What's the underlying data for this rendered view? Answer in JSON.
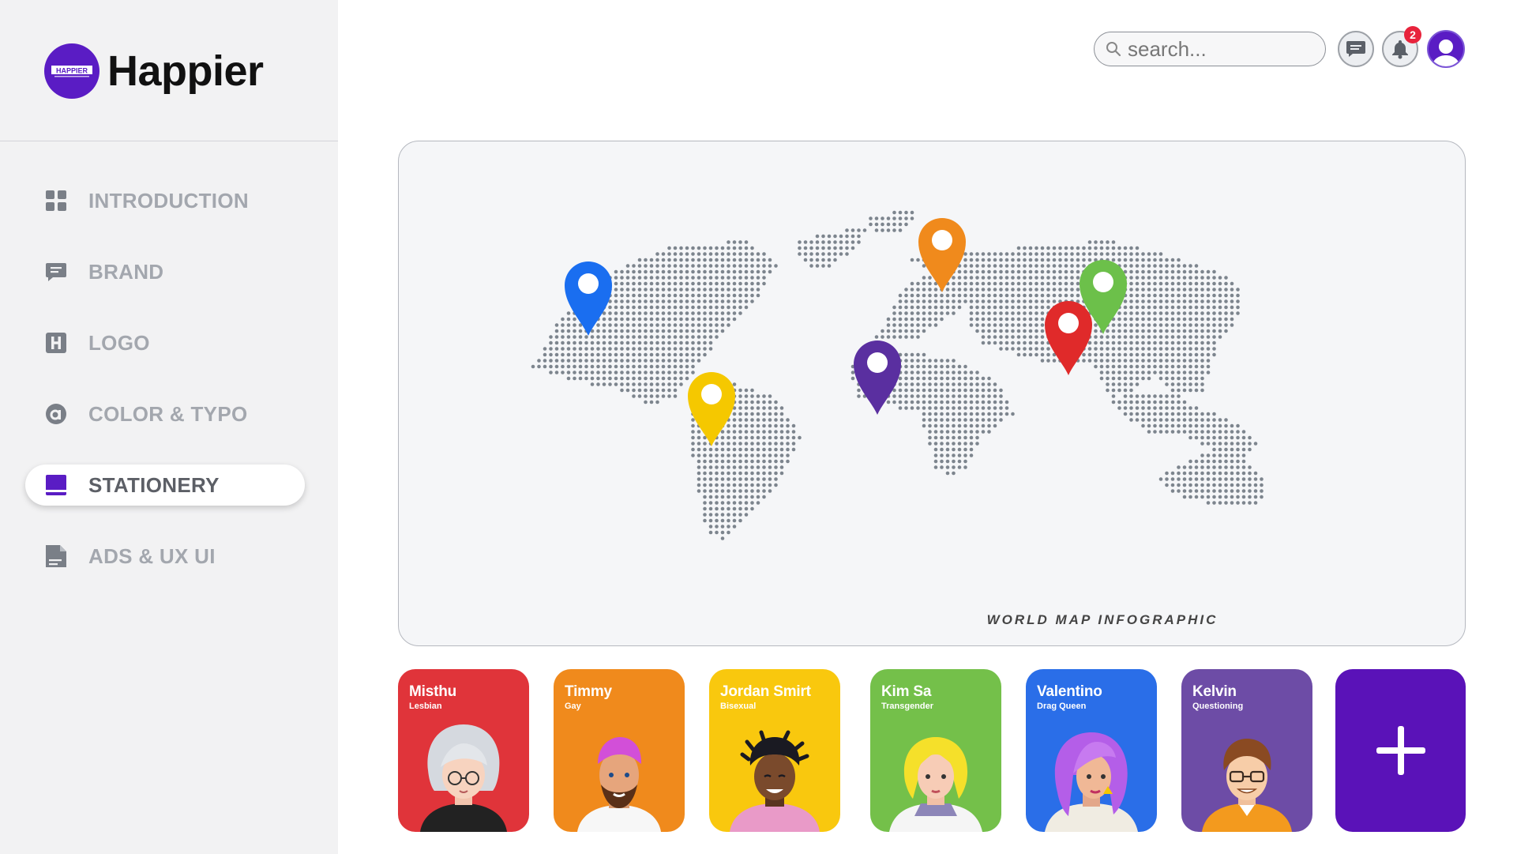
{
  "brand": {
    "name": "Happier",
    "logo_text": "HAPPIER"
  },
  "sidebar": {
    "items": [
      {
        "label": "INTRODUCTION",
        "icon": "grid-icon",
        "active": false
      },
      {
        "label": "BRAND",
        "icon": "chat-bubble-icon",
        "active": false
      },
      {
        "label": "LOGO",
        "icon": "letter-h-icon",
        "active": false
      },
      {
        "label": "COLOR & TYPO",
        "icon": "letter-a-icon",
        "active": false
      },
      {
        "label": "STATIONERY",
        "icon": "book-icon",
        "active": true
      },
      {
        "label": "ADS & UX UI",
        "icon": "document-icon",
        "active": false
      }
    ]
  },
  "header": {
    "search": {
      "placeholder": "search..."
    },
    "notifications": {
      "count": "2"
    },
    "icons": [
      "search-icon",
      "message-icon",
      "bell-icon",
      "user-avatar-icon"
    ]
  },
  "map": {
    "caption": "WORLD MAP INFOGRAPHIC",
    "pin_colors": [
      "#1a6ef0",
      "#f5c800",
      "#f08a1c",
      "#5a2fa0",
      "#e02a2a",
      "#6cc04a"
    ],
    "dot_color": "#7d858e"
  },
  "profiles": [
    {
      "name": "Misthu",
      "role": "Lesbian",
      "color": "#e0343a"
    },
    {
      "name": "Timmy",
      "role": "Gay",
      "color": "#f08a1c"
    },
    {
      "name": "Jordan Smirt",
      "role": "Bisexual",
      "color": "#f9c80e"
    },
    {
      "name": "Kim Sa",
      "role": "Transgender",
      "color": "#74c04a"
    },
    {
      "name": "Valentino",
      "role": "Drag Queen",
      "color": "#2a6ee8"
    },
    {
      "name": "Kelvin",
      "role": "Questioning",
      "color": "#6d4ca6"
    }
  ],
  "add_card": {
    "icon": "plus-icon",
    "color": "#5a12b8"
  },
  "colors": {
    "accent": "#5a1cc4",
    "sidebar_bg": "#f2f2f3",
    "badge": "#e8233c"
  }
}
